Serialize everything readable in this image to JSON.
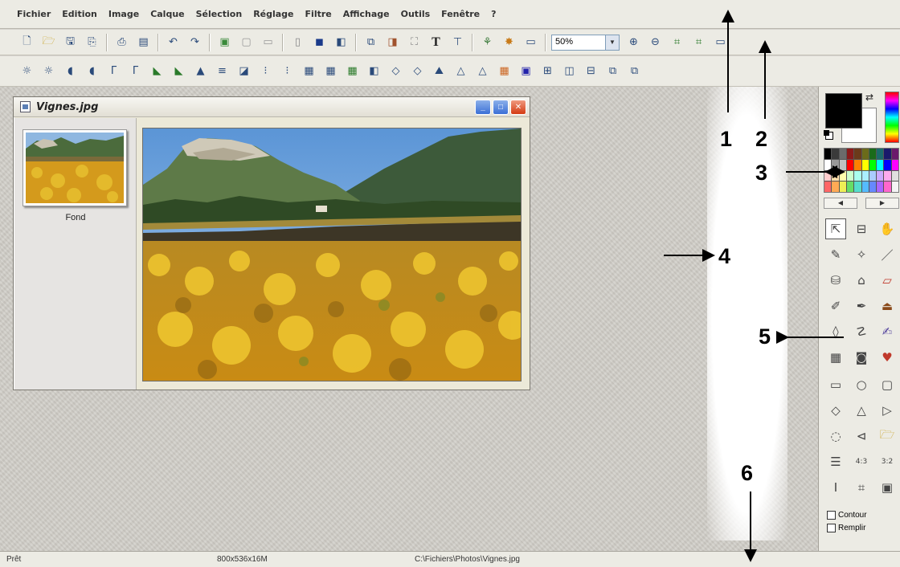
{
  "menu": [
    "Fichier",
    "Edition",
    "Image",
    "Calque",
    "Sélection",
    "Réglage",
    "Filtre",
    "Affichage",
    "Outils",
    "Fenêtre",
    "?"
  ],
  "toolbar1": {
    "zoom_value": "50%",
    "text_tool_label": "T"
  },
  "document": {
    "title": "Vignes.jpg",
    "layer_name": "Fond"
  },
  "palette": {
    "foreground_color": "#000000",
    "background_color": "#ffffff",
    "swatches": [
      "#000000",
      "#3a3a3a",
      "#6b6b6b",
      "#8c1a1a",
      "#6b3a1a",
      "#6b6b1a",
      "#1a6b1a",
      "#1a6b6b",
      "#1a1a6b",
      "#6b1a6b",
      "#ffffff",
      "#999999",
      "#c0c0c0",
      "#ff0000",
      "#ff8000",
      "#ffff00",
      "#00ff00",
      "#00ffff",
      "#0000ff",
      "#ff00ff",
      "#ffcccc",
      "#ffddaa",
      "#ffffaa",
      "#ccffcc",
      "#aaffee",
      "#aaeeff",
      "#aaccff",
      "#ccaaff",
      "#ffaaee",
      "#e0e0e0",
      "#ff6666",
      "#ffaa55",
      "#eeee55",
      "#66dd66",
      "#55ddcc",
      "#55bbff",
      "#6688ff",
      "#aa66ff",
      "#ff66cc",
      "#f4f4f4"
    ],
    "checkbox_outline": "Contour",
    "checkbox_fill": "Remplir"
  },
  "status": {
    "state": "Prêt",
    "image_info": "800x536x16M",
    "file_path": "C:\\Fichiers\\Photos\\Vignes.jpg"
  },
  "callouts": [
    "1",
    "2",
    "3",
    "4",
    "5",
    "6"
  ]
}
